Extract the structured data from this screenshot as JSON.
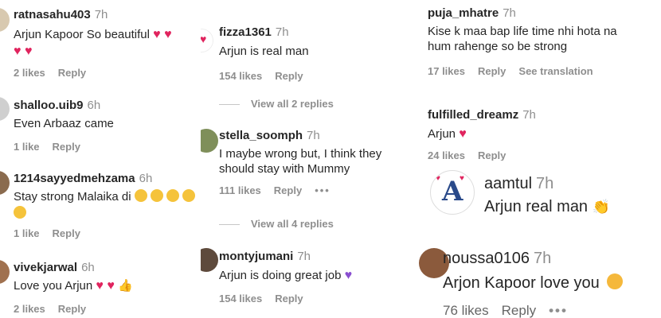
{
  "col1": [
    {
      "user": "ratnasahu403",
      "time": "7h",
      "text": "Arjun Kapoor So beautiful",
      "likes": "2 likes",
      "reply": "Reply"
    },
    {
      "user": "shalloo.uib9",
      "time": "6h",
      "text": "Even Arbaaz came",
      "likes": "1 like",
      "reply": "Reply"
    },
    {
      "user": "1214sayyedmehzama",
      "time": "6h",
      "text": "Stay strong Malaika di",
      "likes": "1 like",
      "reply": "Reply"
    },
    {
      "user": "vivekjarwal",
      "time": "6h",
      "text": "Love you Arjun",
      "likes": "2 likes",
      "reply": "Reply"
    }
  ],
  "col2": [
    {
      "user": "fizza1361",
      "time": "7h",
      "text": "Arjun is real man",
      "likes": "154 likes",
      "reply": "Reply",
      "view_replies": "View all 2 replies"
    },
    {
      "user": "stella_soomph",
      "time": "7h",
      "text": "I maybe wrong but, I think they should stay with Mummy",
      "likes": "111 likes",
      "reply": "Reply",
      "view_replies": "View all 4 replies"
    },
    {
      "user": "montyjumani",
      "time": "7h",
      "text": "Arjun is doing great job",
      "likes": "154 likes",
      "reply": "Reply"
    }
  ],
  "col3": [
    {
      "user": "puja_mhatre",
      "time": "7h",
      "text": "Kise k maa bap life time nhi hota na hum rahenge so be strong",
      "likes": "17 likes",
      "reply": "Reply",
      "see_translation": "See translation"
    },
    {
      "user": "fulfilled_dreamz",
      "time": "7h",
      "text": "Arjun",
      "likes": "24 likes",
      "reply": "Reply"
    },
    {
      "user": "aamtul",
      "time": "7h",
      "text": "Arjun real man"
    },
    {
      "user": "noussa0106",
      "time": "7h",
      "text": "Arjon Kapoor love you",
      "likes": "76 likes",
      "reply": "Reply"
    }
  ],
  "colors": {
    "heart": "#e0245e",
    "muted": "#8e8e8e",
    "text": "#262626"
  }
}
